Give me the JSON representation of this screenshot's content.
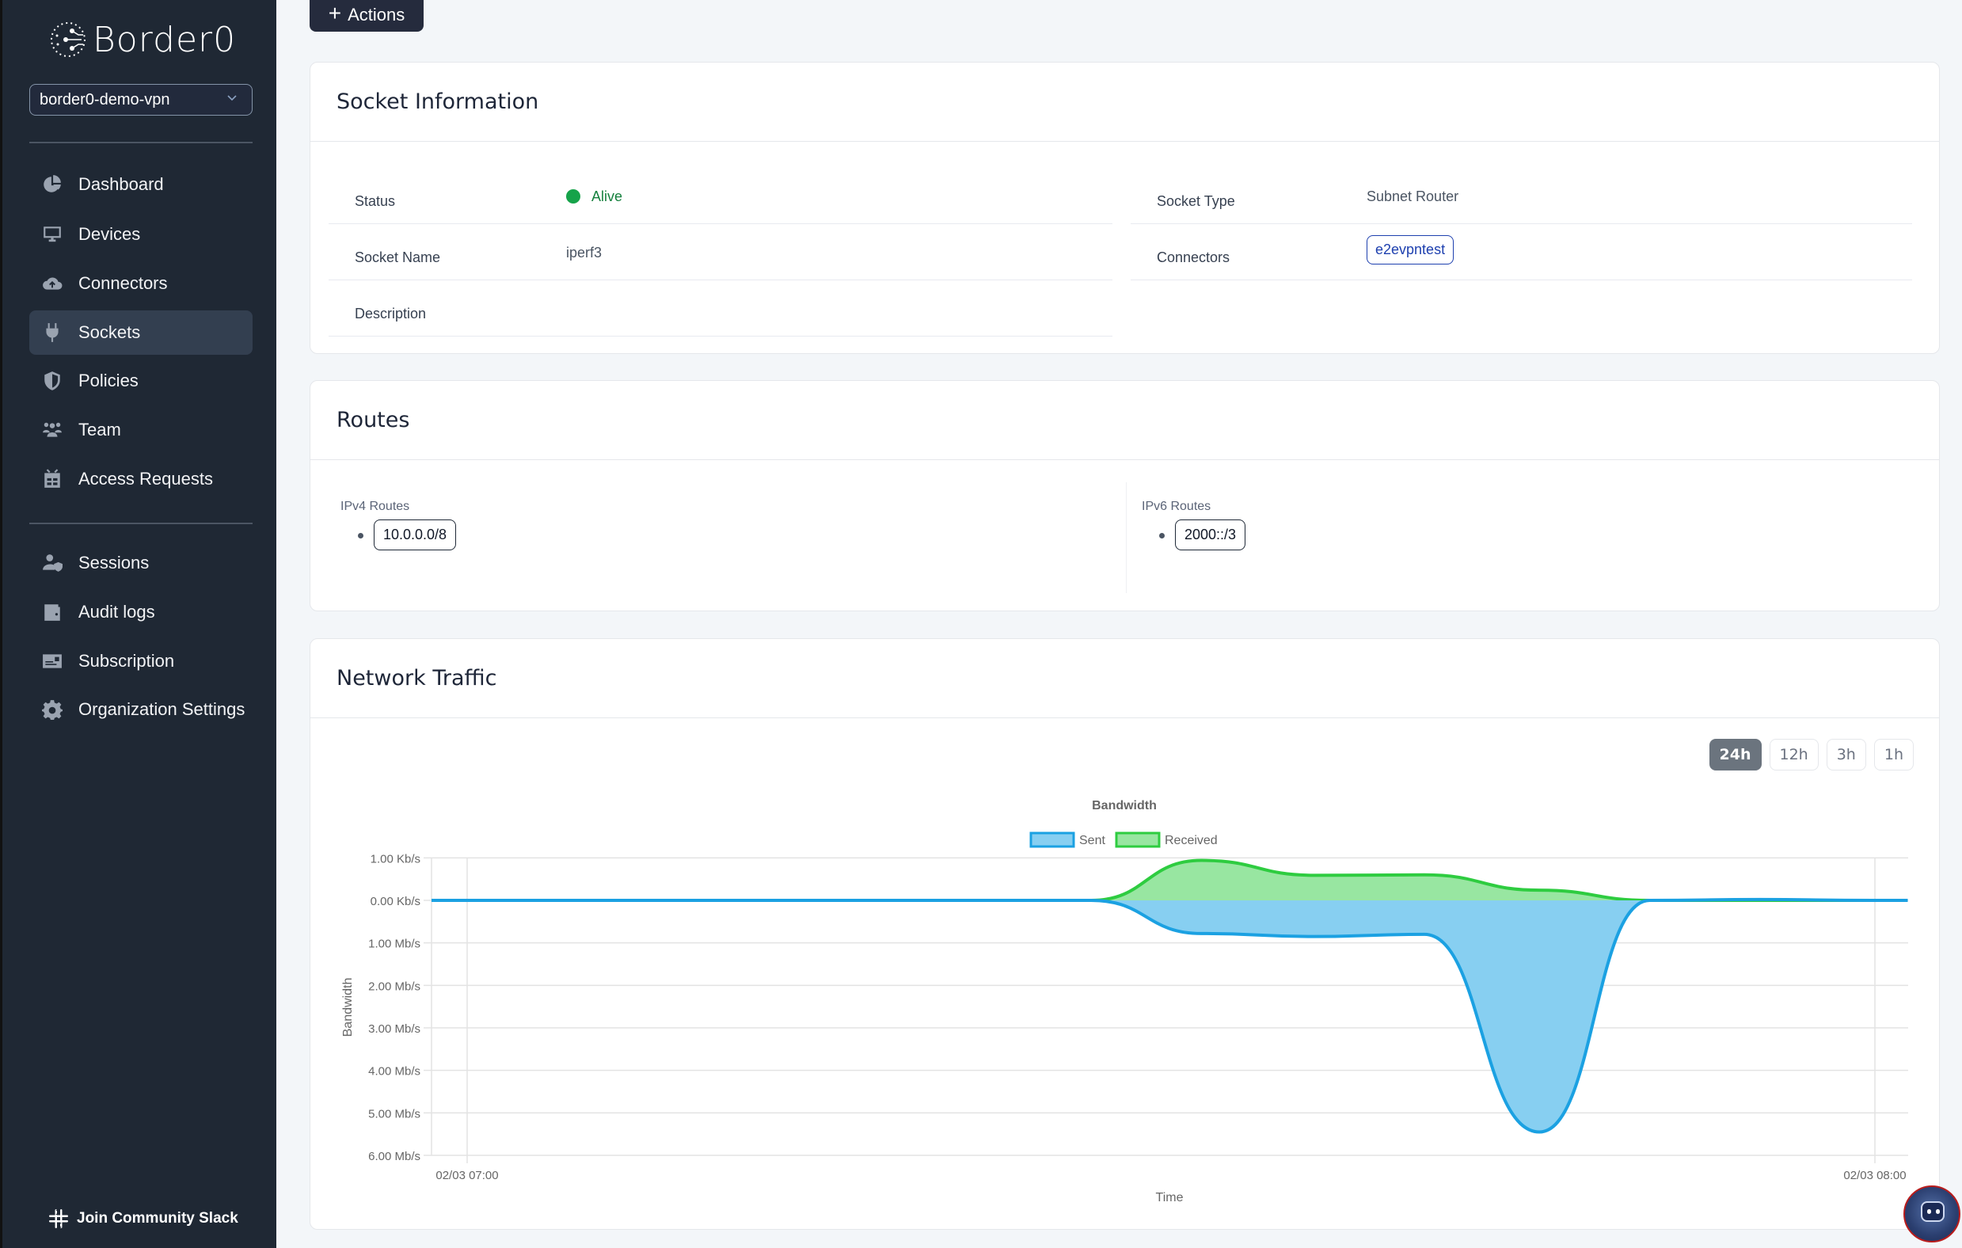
{
  "sidebar": {
    "brand": "Border0",
    "org_select": {
      "value": "border0-demo-vpn"
    },
    "primary_items": [
      {
        "label": "Dashboard",
        "icon": "pie-chart-icon"
      },
      {
        "label": "Devices",
        "icon": "desktop-icon"
      },
      {
        "label": "Connectors",
        "icon": "cloud-upload-icon"
      },
      {
        "label": "Sockets",
        "icon": "plug-icon",
        "active": true
      },
      {
        "label": "Policies",
        "icon": "shield-icon"
      },
      {
        "label": "Team",
        "icon": "users-icon"
      },
      {
        "label": "Access Requests",
        "icon": "robot-icon"
      }
    ],
    "secondary_items": [
      {
        "label": "Sessions",
        "icon": "user-shield-icon"
      },
      {
        "label": "Audit logs",
        "icon": "wallet-icon"
      },
      {
        "label": "Subscription",
        "icon": "id-card-icon"
      },
      {
        "label": "Organization Settings",
        "icon": "gear-icon"
      }
    ],
    "slack_link": "Join Community Slack"
  },
  "toolbar": {
    "actions_label": "Actions",
    "actions_icon": "+"
  },
  "socket_info": {
    "title": "Socket Information",
    "status_label": "Status",
    "status_value": "Alive",
    "status_color": "#16a34a",
    "name_label": "Socket Name",
    "name_value": "iperf3",
    "description_label": "Description",
    "description_value": "",
    "type_label": "Socket Type",
    "type_value": "Subnet Router",
    "connectors_label": "Connectors",
    "connectors": [
      "e2evpntest"
    ]
  },
  "routes": {
    "title": "Routes",
    "ipv4_label": "IPv4 Routes",
    "ipv4": [
      "10.0.0.0/8"
    ],
    "ipv6_label": "IPv6 Routes",
    "ipv6": [
      "2000::/3"
    ]
  },
  "network_traffic": {
    "title": "Network Traffic",
    "ranges": [
      {
        "label": "24h",
        "active": true
      },
      {
        "label": "12h",
        "active": false
      },
      {
        "label": "3h",
        "active": false
      },
      {
        "label": "1h",
        "active": false
      }
    ]
  },
  "chart_data": {
    "type": "area",
    "title": "Bandwidth",
    "xlabel": "Time",
    "ylabel": "Bandwidth",
    "legend": {
      "position": "top-center",
      "entries": [
        "Sent",
        "Received"
      ]
    },
    "colors": {
      "Sent": "#1ba1e2",
      "Sent_fill": "#87cff1",
      "Received": "#2ecc40",
      "Received_fill": "#98e6a1"
    },
    "x_unit": "minutes after 02/03 07:00",
    "x_range": [
      -1.7,
      61.4
    ],
    "x_ticks": [
      {
        "value": 0,
        "label": "02/03 07:00"
      },
      {
        "value": 60,
        "label": "02/03 08:00"
      }
    ],
    "y_ticks": [
      {
        "value": 1,
        "label": "1.00 Kb/s",
        "side": "received"
      },
      {
        "value": 0,
        "label": "0.00 Kb/s"
      },
      {
        "value": -1,
        "label": "1.00 Mb/s"
      },
      {
        "value": -2,
        "label": "2.00 Mb/s"
      },
      {
        "value": -3,
        "label": "3.00 Mb/s"
      },
      {
        "value": -4,
        "label": "4.00 Mb/s"
      },
      {
        "value": -5,
        "label": "5.00 Mb/s"
      },
      {
        "value": -6,
        "label": "6.00 Mb/s"
      }
    ],
    "ylim": [
      -6,
      1
    ],
    "grid": true,
    "x": [
      -1.7,
      2.8,
      7.5,
      12.3,
      17.0,
      21.8,
      26.6,
      31.3,
      36.1,
      40.8,
      45.7,
      50.4,
      55.1,
      59.9,
      61.4
    ],
    "series": [
      {
        "name": "Received",
        "unit": "Kb/s",
        "values": [
          0,
          0,
          0,
          0,
          0,
          0,
          0,
          0.94,
          0.59,
          0.6,
          0.24,
          0,
          0,
          0,
          0
        ]
      },
      {
        "name": "Sent",
        "unit": "Mb/s",
        "values": [
          0,
          0,
          0,
          0,
          0,
          0,
          0,
          0.78,
          0.85,
          0.8,
          5.45,
          0,
          -0.02,
          0,
          0
        ]
      }
    ]
  }
}
